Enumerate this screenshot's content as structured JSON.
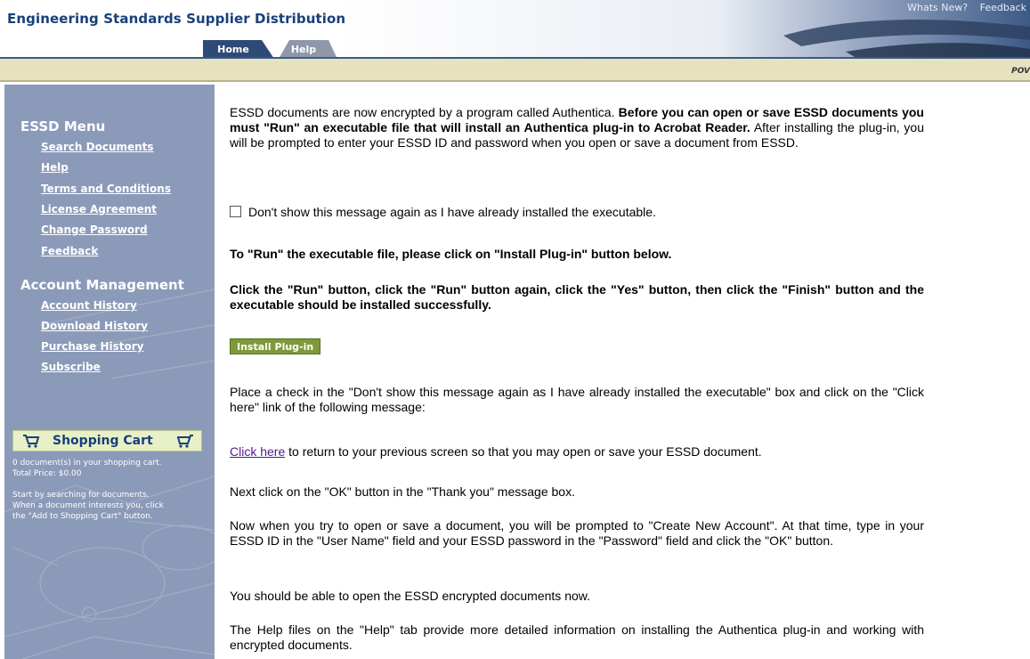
{
  "header": {
    "site_title": "Engineering Standards Supplier Distribution",
    "top_links": [
      "Whats New?",
      "Feedback"
    ],
    "tabs": [
      {
        "label": "Home"
      },
      {
        "label": "Help"
      }
    ],
    "band_text": "POV"
  },
  "sidebar": {
    "essd_menu": {
      "heading": "ESSD Menu",
      "items": [
        "Search Documents",
        "Help",
        "Terms and Conditions",
        "License Agreement",
        "Change Password",
        "Feedback"
      ]
    },
    "account_management": {
      "heading": "Account Management",
      "items": [
        "Account History",
        "Download History",
        "Purchase History",
        "Subscribe"
      ]
    },
    "cart": {
      "title": "Shopping Cart",
      "count_text": "0  document(s) in your shopping cart.",
      "total_text": "Total Price:  $0.00",
      "hint_line1": "Start by searching for documents.",
      "hint_line2": "When a document interests you, click",
      "hint_line3": "the \"Add to Shopping Cart\" button."
    }
  },
  "main": {
    "intro_normal": "ESSD documents are now encrypted by a program called Authentica. ",
    "intro_bold": "Before you can open or save ESSD documents you must \"Run\" an executable file that will install an Authentica plug-in to Acrobat Reader.",
    "intro_end": " After installing the plug-in, you will be prompted to enter your ESSD ID and password when you open or save a document from ESSD.",
    "checkbox_label": "Don't show this message again as I have already installed the executable.",
    "run_instruction": "To \"Run\" the executable file, please click on \"Install Plug-in\" button below.",
    "click_instruction": "Click the \"Run\" button, click the \"Run\" button again, click the \"Yes\" button, then click the \"Finish\" button and the executable should be installed successfully.",
    "install_button": "Install Plug-in",
    "place_check": "Place a check in the \"Don't show this message again as I have already installed the executable\" box and click on the \"Click here\" link of the following message:",
    "click_here_link": "Click here",
    "click_here_rest": " to return to your previous screen so that you may open or save your ESSD document.",
    "next_click": "Next click on the \"OK\" button in the \"Thank you\" message box.",
    "now_when": "Now when you try to open or save a document, you will be prompted to \"Create New Account\". At that time, type in your ESSD ID in the \"User Name\" field and your ESSD password in the \"Password\" field and click the \"OK\" button.",
    "should_be_able": "You should be able to open the ESSD encrypted documents now.",
    "help_files": "The Help files on the \"Help\" tab provide more detailed information on installing the Authentica plug-in and working with encrypted documents."
  },
  "colors": {
    "title_blue": "#17407a",
    "sidebar_bg": "#8c9ab9",
    "band": "#e6e2bf",
    "button_green": "#7e9a3a"
  }
}
